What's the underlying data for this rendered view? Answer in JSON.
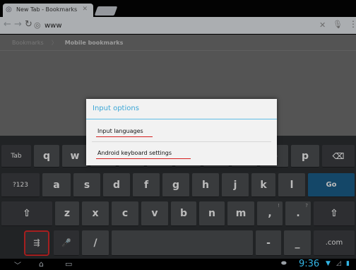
{
  "browser": {
    "tab_title": "New Tab - Bookmarks",
    "url": "www",
    "breadcrumb": [
      "Bookmarks",
      "Mobile bookmarks"
    ]
  },
  "dialog": {
    "title": "Input options",
    "items": [
      "Input languages",
      "Android keyboard settings"
    ]
  },
  "keyboard": {
    "row1": [
      "Tab",
      "q",
      "w",
      "e",
      "r",
      "t",
      "y",
      "u",
      "i",
      "o",
      "p",
      "⌫"
    ],
    "row2": [
      "?123",
      "a",
      "s",
      "d",
      "f",
      "g",
      "h",
      "j",
      "k",
      "l",
      "Go"
    ],
    "row3": [
      "⇧",
      "z",
      "x",
      "c",
      "v",
      "b",
      "n",
      "m",
      ",",
      ".",
      "⇧"
    ],
    "row4": [
      "⚙",
      "🎤",
      "/",
      "",
      "-",
      "_",
      ".com"
    ],
    "row3_hints": [
      "!",
      "?"
    ]
  },
  "status": {
    "time": "9:36"
  },
  "colors": {
    "accent": "#33b5e5",
    "underline": "#d62020",
    "go_key": "#1a5c86"
  }
}
